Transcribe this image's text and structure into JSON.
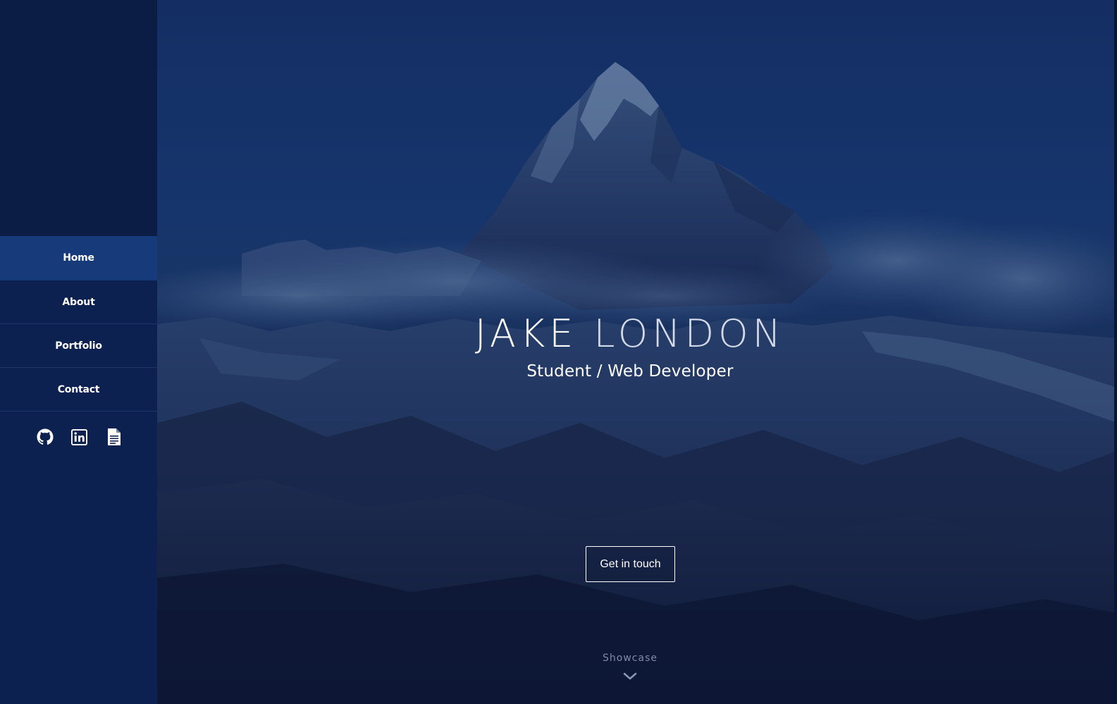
{
  "sidebar": {
    "nav": [
      {
        "label": "Home",
        "active": true
      },
      {
        "label": "About",
        "active": false
      },
      {
        "label": "Portfolio",
        "active": false
      },
      {
        "label": "Contact",
        "active": false
      }
    ],
    "social_icons": [
      "github-icon",
      "linkedin-icon",
      "document-icon"
    ]
  },
  "hero": {
    "first_name": "JAKE",
    "last_name": "LONDON",
    "subtitle": "Student / Web Developer",
    "cta_label": "Get in touch",
    "scroll_label": "Showcase",
    "scroll_icon": "chevron-down-icon"
  },
  "colors": {
    "sidebar_bg": "#0c2150",
    "sidebar_top": "#0b1c45",
    "nav_active": "#173a7a",
    "text": "#ffffff",
    "muted": "#7f8aa3"
  }
}
